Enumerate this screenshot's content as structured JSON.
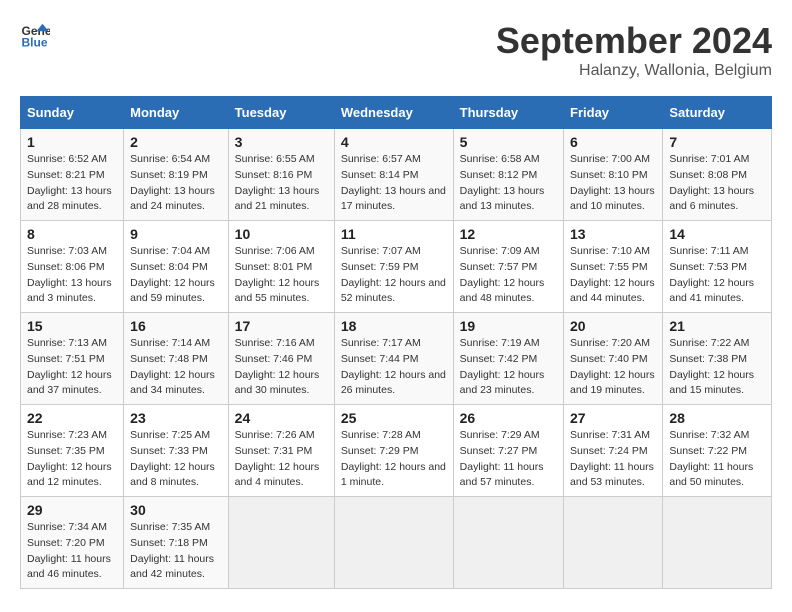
{
  "logo": {
    "general": "General",
    "blue": "Blue"
  },
  "title": "September 2024",
  "location": "Halanzy, Wallonia, Belgium",
  "headers": [
    "Sunday",
    "Monday",
    "Tuesday",
    "Wednesday",
    "Thursday",
    "Friday",
    "Saturday"
  ],
  "rows": [
    [
      {
        "day": "1",
        "sunrise": "Sunrise: 6:52 AM",
        "sunset": "Sunset: 8:21 PM",
        "daylight": "Daylight: 13 hours and 28 minutes."
      },
      {
        "day": "2",
        "sunrise": "Sunrise: 6:54 AM",
        "sunset": "Sunset: 8:19 PM",
        "daylight": "Daylight: 13 hours and 24 minutes."
      },
      {
        "day": "3",
        "sunrise": "Sunrise: 6:55 AM",
        "sunset": "Sunset: 8:16 PM",
        "daylight": "Daylight: 13 hours and 21 minutes."
      },
      {
        "day": "4",
        "sunrise": "Sunrise: 6:57 AM",
        "sunset": "Sunset: 8:14 PM",
        "daylight": "Daylight: 13 hours and 17 minutes."
      },
      {
        "day": "5",
        "sunrise": "Sunrise: 6:58 AM",
        "sunset": "Sunset: 8:12 PM",
        "daylight": "Daylight: 13 hours and 13 minutes."
      },
      {
        "day": "6",
        "sunrise": "Sunrise: 7:00 AM",
        "sunset": "Sunset: 8:10 PM",
        "daylight": "Daylight: 13 hours and 10 minutes."
      },
      {
        "day": "7",
        "sunrise": "Sunrise: 7:01 AM",
        "sunset": "Sunset: 8:08 PM",
        "daylight": "Daylight: 13 hours and 6 minutes."
      }
    ],
    [
      {
        "day": "8",
        "sunrise": "Sunrise: 7:03 AM",
        "sunset": "Sunset: 8:06 PM",
        "daylight": "Daylight: 13 hours and 3 minutes."
      },
      {
        "day": "9",
        "sunrise": "Sunrise: 7:04 AM",
        "sunset": "Sunset: 8:04 PM",
        "daylight": "Daylight: 12 hours and 59 minutes."
      },
      {
        "day": "10",
        "sunrise": "Sunrise: 7:06 AM",
        "sunset": "Sunset: 8:01 PM",
        "daylight": "Daylight: 12 hours and 55 minutes."
      },
      {
        "day": "11",
        "sunrise": "Sunrise: 7:07 AM",
        "sunset": "Sunset: 7:59 PM",
        "daylight": "Daylight: 12 hours and 52 minutes."
      },
      {
        "day": "12",
        "sunrise": "Sunrise: 7:09 AM",
        "sunset": "Sunset: 7:57 PM",
        "daylight": "Daylight: 12 hours and 48 minutes."
      },
      {
        "day": "13",
        "sunrise": "Sunrise: 7:10 AM",
        "sunset": "Sunset: 7:55 PM",
        "daylight": "Daylight: 12 hours and 44 minutes."
      },
      {
        "day": "14",
        "sunrise": "Sunrise: 7:11 AM",
        "sunset": "Sunset: 7:53 PM",
        "daylight": "Daylight: 12 hours and 41 minutes."
      }
    ],
    [
      {
        "day": "15",
        "sunrise": "Sunrise: 7:13 AM",
        "sunset": "Sunset: 7:51 PM",
        "daylight": "Daylight: 12 hours and 37 minutes."
      },
      {
        "day": "16",
        "sunrise": "Sunrise: 7:14 AM",
        "sunset": "Sunset: 7:48 PM",
        "daylight": "Daylight: 12 hours and 34 minutes."
      },
      {
        "day": "17",
        "sunrise": "Sunrise: 7:16 AM",
        "sunset": "Sunset: 7:46 PM",
        "daylight": "Daylight: 12 hours and 30 minutes."
      },
      {
        "day": "18",
        "sunrise": "Sunrise: 7:17 AM",
        "sunset": "Sunset: 7:44 PM",
        "daylight": "Daylight: 12 hours and 26 minutes."
      },
      {
        "day": "19",
        "sunrise": "Sunrise: 7:19 AM",
        "sunset": "Sunset: 7:42 PM",
        "daylight": "Daylight: 12 hours and 23 minutes."
      },
      {
        "day": "20",
        "sunrise": "Sunrise: 7:20 AM",
        "sunset": "Sunset: 7:40 PM",
        "daylight": "Daylight: 12 hours and 19 minutes."
      },
      {
        "day": "21",
        "sunrise": "Sunrise: 7:22 AM",
        "sunset": "Sunset: 7:38 PM",
        "daylight": "Daylight: 12 hours and 15 minutes."
      }
    ],
    [
      {
        "day": "22",
        "sunrise": "Sunrise: 7:23 AM",
        "sunset": "Sunset: 7:35 PM",
        "daylight": "Daylight: 12 hours and 12 minutes."
      },
      {
        "day": "23",
        "sunrise": "Sunrise: 7:25 AM",
        "sunset": "Sunset: 7:33 PM",
        "daylight": "Daylight: 12 hours and 8 minutes."
      },
      {
        "day": "24",
        "sunrise": "Sunrise: 7:26 AM",
        "sunset": "Sunset: 7:31 PM",
        "daylight": "Daylight: 12 hours and 4 minutes."
      },
      {
        "day": "25",
        "sunrise": "Sunrise: 7:28 AM",
        "sunset": "Sunset: 7:29 PM",
        "daylight": "Daylight: 12 hours and 1 minute."
      },
      {
        "day": "26",
        "sunrise": "Sunrise: 7:29 AM",
        "sunset": "Sunset: 7:27 PM",
        "daylight": "Daylight: 11 hours and 57 minutes."
      },
      {
        "day": "27",
        "sunrise": "Sunrise: 7:31 AM",
        "sunset": "Sunset: 7:24 PM",
        "daylight": "Daylight: 11 hours and 53 minutes."
      },
      {
        "day": "28",
        "sunrise": "Sunrise: 7:32 AM",
        "sunset": "Sunset: 7:22 PM",
        "daylight": "Daylight: 11 hours and 50 minutes."
      }
    ],
    [
      {
        "day": "29",
        "sunrise": "Sunrise: 7:34 AM",
        "sunset": "Sunset: 7:20 PM",
        "daylight": "Daylight: 11 hours and 46 minutes."
      },
      {
        "day": "30",
        "sunrise": "Sunrise: 7:35 AM",
        "sunset": "Sunset: 7:18 PM",
        "daylight": "Daylight: 11 hours and 42 minutes."
      },
      null,
      null,
      null,
      null,
      null
    ]
  ]
}
